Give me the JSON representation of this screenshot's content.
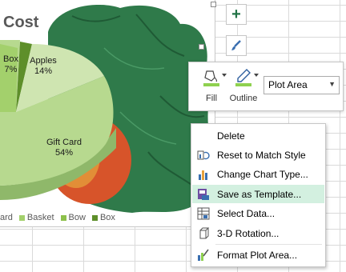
{
  "chart": {
    "title": "Cost",
    "slice_labels": [
      {
        "name": "Box",
        "pct": "7%"
      },
      {
        "name": "Apples",
        "pct": "14%"
      },
      {
        "name": "Gift Card",
        "pct": "54%"
      }
    ],
    "legend": [
      {
        "label": "ard",
        "color": "#b7d98f"
      },
      {
        "label": "Basket",
        "color": "#a3d06c"
      },
      {
        "label": "Bow",
        "color": "#8dc14b"
      },
      {
        "label": "Box",
        "color": "#5e8f2a"
      }
    ]
  },
  "side_buttons": {
    "chart_elements_icon": "plus-icon",
    "chart_styles_icon": "paintbrush-icon"
  },
  "mini_toolbar": {
    "fill_label": "Fill",
    "outline_label": "Outline",
    "element_select_value": "Plot Area"
  },
  "context_menu": {
    "items": [
      {
        "label": "Delete",
        "icon": "none",
        "highlighted": false
      },
      {
        "label": "Reset to Match Style",
        "icon": "reset-style-icon",
        "highlighted": false
      },
      {
        "label": "Change Chart Type...",
        "icon": "chart-type-icon",
        "highlighted": false
      },
      {
        "label": "Save as Template...",
        "icon": "template-icon",
        "highlighted": true
      },
      {
        "label": "Select Data...",
        "icon": "select-data-icon",
        "highlighted": false
      },
      {
        "label": "3-D Rotation...",
        "icon": "rotation-icon",
        "highlighted": false
      },
      {
        "label": "Format Plot Area...",
        "icon": "format-area-icon",
        "highlighted": false
      }
    ],
    "highlight_color": "#d3f0e0"
  }
}
